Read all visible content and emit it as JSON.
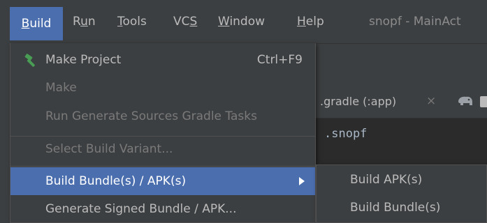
{
  "menubar": {
    "items": [
      {
        "label": "Build",
        "mnemonic": "B",
        "rest": "uild",
        "active": true
      },
      {
        "label": "Run",
        "pre": "R",
        "mnemonic": "u",
        "rest": "n"
      },
      {
        "label": "Tools",
        "mnemonic": "T",
        "rest": "ools"
      },
      {
        "label": "VCS",
        "pre": "VC",
        "mnemonic": "S",
        "rest": ""
      },
      {
        "label": "Window",
        "mnemonic": "W",
        "rest": "indow"
      },
      {
        "label": "Help",
        "mnemonic": "H",
        "rest": "elp"
      }
    ],
    "window_title": "snopf - MainAct"
  },
  "build_menu": {
    "items": [
      {
        "label": "Make Project",
        "shortcut": "Ctrl+F9",
        "icon": "hammer-icon",
        "enabled": true
      },
      {
        "label": "Make",
        "enabled": false
      },
      {
        "label": "Run Generate Sources Gradle Tasks",
        "enabled": false
      },
      {
        "label": "Select Build Variant...",
        "enabled": false
      },
      {
        "label": "Build Bundle(s) / APK(s)",
        "has_submenu": true,
        "selected": true,
        "enabled": true
      },
      {
        "label": "Generate Signed Bundle / APK...",
        "enabled": true
      }
    ]
  },
  "submenu": {
    "items": [
      {
        "label": "Build APK(s)"
      },
      {
        "label": "Build Bundle(s)"
      }
    ]
  },
  "editor": {
    "tab_label": ".gradle (:app)",
    "tab_close": "×",
    "code_line": ".snopf"
  },
  "colors": {
    "accent": "#4b6eaf",
    "menu_bg": "#3c3f41",
    "editor_bg": "#2b2b2b",
    "hammer": "#499c54"
  }
}
